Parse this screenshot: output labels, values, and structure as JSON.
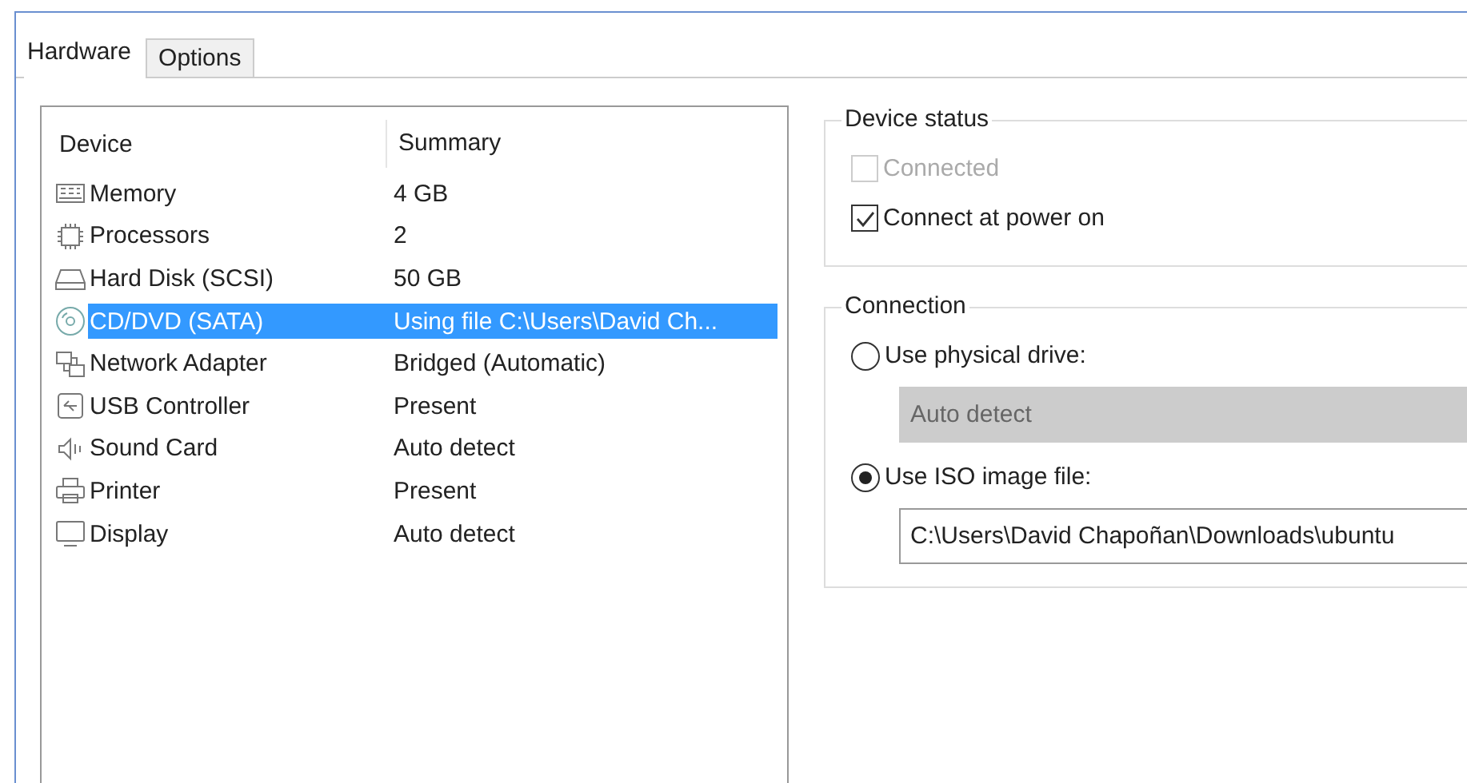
{
  "tabs": [
    {
      "label": "Hardware",
      "selected": true
    },
    {
      "label": "Options",
      "selected": false
    }
  ],
  "device_list": {
    "columns": [
      "Device",
      "Summary"
    ],
    "rows": [
      {
        "kind": "memory",
        "device": "Memory",
        "summary": "4 GB",
        "selected": false
      },
      {
        "kind": "processor",
        "device": "Processors",
        "summary": "2",
        "selected": false
      },
      {
        "kind": "disk",
        "device": "Hard Disk (SCSI)",
        "summary": "50 GB",
        "selected": false
      },
      {
        "kind": "cd",
        "device": "CD/DVD (SATA)",
        "summary": "Using file C:\\Users\\David Ch...",
        "selected": true
      },
      {
        "kind": "network",
        "device": "Network Adapter",
        "summary": "Bridged (Automatic)",
        "selected": false
      },
      {
        "kind": "usb",
        "device": "USB Controller",
        "summary": "Present",
        "selected": false
      },
      {
        "kind": "sound",
        "device": "Sound Card",
        "summary": "Auto detect",
        "selected": false
      },
      {
        "kind": "printer",
        "device": "Printer",
        "summary": "Present",
        "selected": false
      },
      {
        "kind": "display",
        "device": "Display",
        "summary": "Auto detect",
        "selected": false
      }
    ]
  },
  "device_status": {
    "title": "Device status",
    "checkboxes": [
      {
        "label": "Connected",
        "checked": false,
        "disabled": true
      },
      {
        "label": "Connect at power on",
        "checked": true,
        "disabled": false
      }
    ]
  },
  "connection": {
    "title": "Connection",
    "physical_drive": {
      "label": "Use physical drive:",
      "selected": false,
      "dropdown_value": "Auto detect",
      "disabled": true
    },
    "iso_image": {
      "label": "Use ISO image file:",
      "selected": true,
      "path": "C:\\Users\\David Chapoñan\\Downloads\\ubuntu"
    }
  }
}
